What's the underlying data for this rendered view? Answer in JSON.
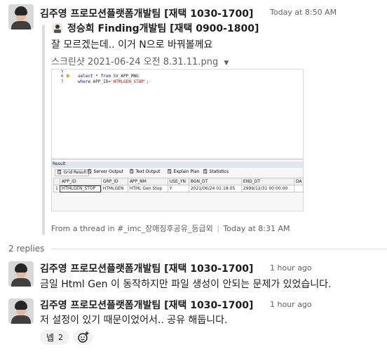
{
  "colors": {
    "accent": "#1264a3",
    "muted": "#616061",
    "divider": "#dddddd",
    "bg": "#ffffff"
  },
  "main_message": {
    "author": "김주영 프로모션플랫폼개발팀 [재택 1030-1700]",
    "timestamp": "Today at 8:50 AM",
    "shared": {
      "author_icon": "person-icon",
      "author": "정승희 Finding개발팀 [재택 0900-1800]",
      "text": "잘 모르겠는데.. 이거 N으로 바꿔볼께요",
      "file_name": "스크린샷 2021-06-24 오전 8.31.11.png",
      "footer_prefix": "From a thread in ",
      "channel": "#_imc_장애징후공유_등급외",
      "footer_sep": "|",
      "footer_time": "Today at 8:31 AM"
    }
  },
  "screenshot": {
    "code_lines": [
      {
        "num": "5",
        "text": ""
      },
      {
        "num": "6",
        "kw1": "select",
        "mid1": " * ",
        "kw2": "from",
        "rest": " SV_APP_MNG"
      },
      {
        "num": "7",
        "kw1": "where",
        "mid1": " APP_ID=",
        "str": "'HTMLGEN_STOP'",
        "rest": ";"
      }
    ],
    "result_label": "Result",
    "tabs": [
      "Grid Result",
      "Server Output",
      "Text Output",
      "Explain Plan",
      "Statistics"
    ],
    "columns": [
      "APP_ID",
      "GRP_ID",
      "APP_NM",
      "USE_YN",
      "BGN_DT",
      "END_DT",
      "DA"
    ],
    "rows": [
      [
        "1",
        "HTMLGEN_STOP",
        "HTMLGEN",
        "HTML Gen Stop",
        "Y",
        "2021/06/24 01:18:05",
        "2999/12/31 00:00:00",
        ""
      ]
    ]
  },
  "replies_label": "2 replies",
  "replies": [
    {
      "author": "김주영 프로모션플랫폼개발팀 [재택 1030-1700]",
      "timestamp": "1 hour ago",
      "text": "금일 Html Gen 이 동작하지만 파일 생성이 안되는 문제가 있었습니다."
    },
    {
      "author": "김주영 프로모션플랫폼개발팀 [재택 1030-1700]",
      "timestamp": "1 hour ago",
      "text": "저 설정이 있기 때문이었어서.. 공유 해둡니다."
    }
  ],
  "reaction": {
    "emoji": "넵",
    "count": "2"
  },
  "add_reaction_icon": "add-reaction-icon"
}
